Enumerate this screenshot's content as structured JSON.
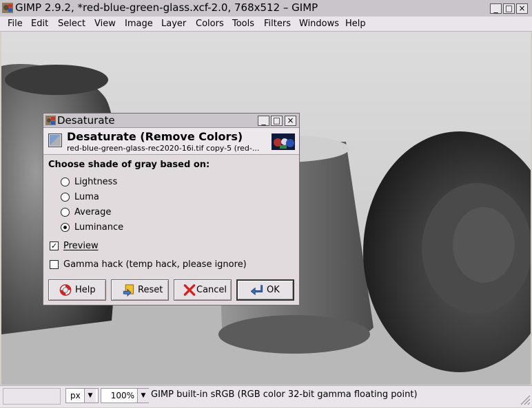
{
  "window": {
    "title": "GIMP 2.9.2, *red-blue-green-glass.xcf-2.0, 768x512 – GIMP",
    "controls": [
      "_",
      "□",
      "×"
    ]
  },
  "menubar": {
    "items": [
      "File",
      "Edit",
      "Select",
      "View",
      "Image",
      "Layer",
      "Colors",
      "Tools",
      "Filters",
      "Windows",
      "Help"
    ]
  },
  "dialog": {
    "title": "Desaturate",
    "heading": "Desaturate (Remove Colors)",
    "subtitle": "red-blue-green-glass-rec2020-16i.tif copy-5 (red-...",
    "section_label": "Choose shade of gray based on:",
    "options": [
      {
        "label": "Lightness",
        "selected": false
      },
      {
        "label": "Luma",
        "selected": false
      },
      {
        "label": "Average",
        "selected": false
      },
      {
        "label": "Luminance",
        "selected": true
      }
    ],
    "preview": {
      "label": "Preview",
      "checked": true
    },
    "gamma_hack": {
      "label": "Gamma hack (temp hack, please ignore)",
      "checked": false
    },
    "buttons": {
      "help": "Help",
      "reset": "Reset",
      "cancel": "Cancel",
      "ok": "OK"
    }
  },
  "statusbar": {
    "unit": "px",
    "zoom": "100%",
    "message": "GIMP built-in sRGB (RGB color 32-bit gamma floating point)"
  },
  "icons": {
    "app": "gimp-icon",
    "dialog": "desaturate-icon",
    "help": "lifebuoy-icon",
    "reset": "reset-icon",
    "cancel": "cancel-x-icon",
    "ok": "ok-arrow-icon"
  },
  "colors": {
    "chrome": "#e9e5ea",
    "dialog_bg": "#e1dbde",
    "cancel_red": "#d42020",
    "ok_blue": "#3c6fc0"
  }
}
